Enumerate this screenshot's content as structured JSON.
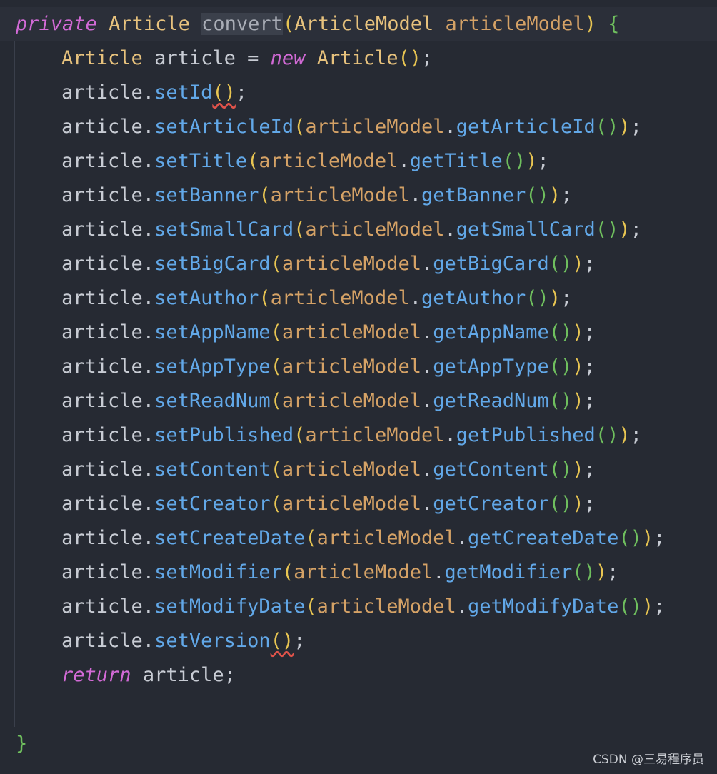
{
  "signature": {
    "modifier": "private",
    "return_type": "Article",
    "method_name": "convert",
    "open_paren": "(",
    "param_type": "ArticleModel",
    "param_name": "articleModel",
    "close_paren": ")",
    "open_brace": "{"
  },
  "declaration": {
    "type": "Article",
    "var": "article",
    "assign": "=",
    "new_kw": "new",
    "ctor": "Article",
    "parens": "()",
    "semi": ";"
  },
  "set_id": {
    "target": "article",
    "method": "setId",
    "parens": "()",
    "semi": ";"
  },
  "setters": [
    {
      "method": "setArticleId",
      "getter": "getArticleId"
    },
    {
      "method": "setTitle",
      "getter": "getTitle"
    },
    {
      "method": "setBanner",
      "getter": "getBanner"
    },
    {
      "method": "setSmallCard",
      "getter": "getSmallCard"
    },
    {
      "method": "setBigCard",
      "getter": "getBigCard"
    },
    {
      "method": "setAuthor",
      "getter": "getAuthor"
    },
    {
      "method": "setAppName",
      "getter": "getAppName"
    },
    {
      "method": "setAppType",
      "getter": "getAppType"
    },
    {
      "method": "setReadNum",
      "getter": "getReadNum"
    },
    {
      "method": "setPublished",
      "getter": "getPublished"
    },
    {
      "method": "setContent",
      "getter": "getContent"
    },
    {
      "method": "setCreator",
      "getter": "getCreator"
    },
    {
      "method": "setCreateDate",
      "getter": "getCreateDate"
    },
    {
      "method": "setModifier",
      "getter": "getModifier"
    },
    {
      "method": "setModifyDate",
      "getter": "getModifyDate"
    }
  ],
  "setter_common": {
    "target": "article",
    "source": "articleModel",
    "dot": ".",
    "open": "(",
    "inner": "()",
    "close": ")",
    "semi": ";"
  },
  "set_version": {
    "target": "article",
    "method": "setVersion",
    "parens": "()",
    "semi": ";"
  },
  "return_stmt": {
    "kw": "return",
    "value": "article",
    "semi": ";"
  },
  "closing_brace": "}",
  "watermark": "CSDN @三易程序员"
}
